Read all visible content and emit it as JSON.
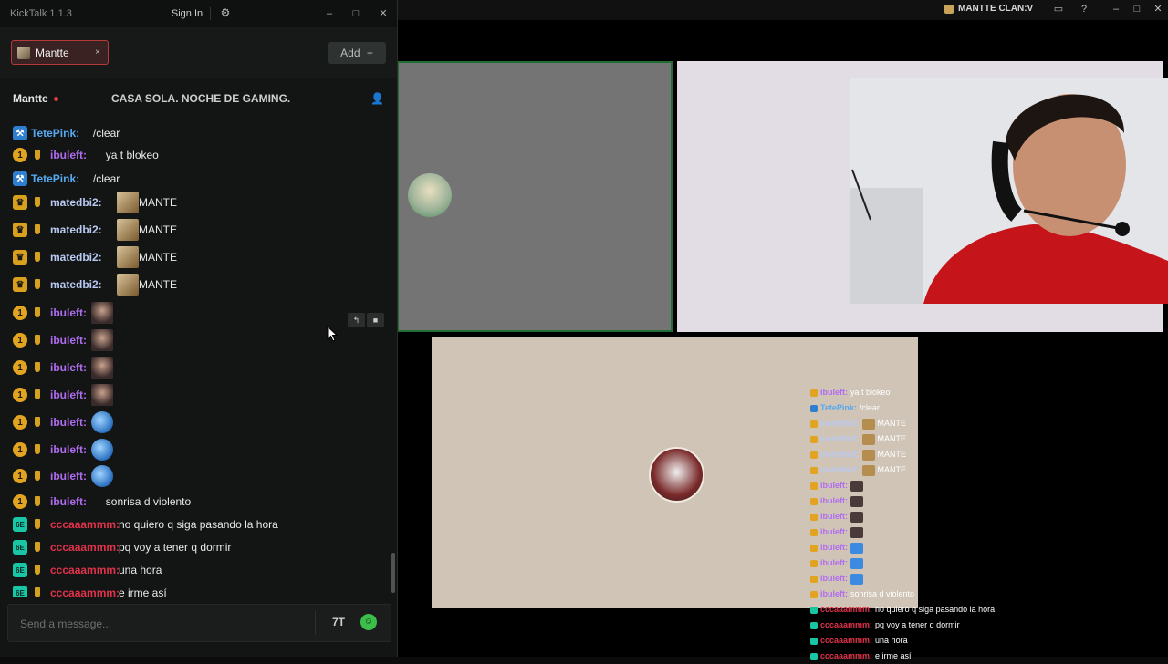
{
  "stream_window": {
    "title": "MANTTE CLAN:V"
  },
  "kicktalk": {
    "app_title": "KickTalk 1.1.3",
    "sign_in_label": "Sign In",
    "tab_label": "Mantte",
    "tab_close": "×",
    "add_label": "Add",
    "add_icon": "+",
    "channel_name": "Mantte",
    "stream_title": "CASA SOLA. NOCHE DE GAMING.",
    "input_placeholder": "Send a message..."
  },
  "chat_messages": [
    {
      "badge": "mod",
      "sub": false,
      "user": "TetePink:",
      "user_color": "#56a8f0",
      "text": "/clear"
    },
    {
      "badge": "gold",
      "sub": true,
      "user": "ibuleft:",
      "user_color": "#b06cf0",
      "text": "ya t blokeo"
    },
    {
      "badge": "mod",
      "sub": false,
      "user": "TetePink:",
      "user_color": "#56a8f0",
      "text": "/clear"
    },
    {
      "badge": "crown",
      "sub": true,
      "user": "matedbi2:",
      "user_color": "#b9c9f2",
      "text": "MANTE"
    },
    {
      "badge": "crown",
      "sub": true,
      "user": "matedbi2:",
      "user_color": "#b9c9f2",
      "text": "MANTE"
    },
    {
      "badge": "crown",
      "sub": true,
      "user": "matedbi2:",
      "user_color": "#b9c9f2",
      "text": "MANTE"
    },
    {
      "badge": "crown",
      "sub": true,
      "user": "matedbi2:",
      "user_color": "#b9c9f2",
      "text": "MANTE"
    },
    {
      "badge": "gold",
      "sub": true,
      "user": "ibuleft:",
      "user_color": "#b06cf0",
      "text": ""
    },
    {
      "badge": "gold",
      "sub": true,
      "user": "ibuleft:",
      "user_color": "#b06cf0",
      "text": ""
    },
    {
      "badge": "gold",
      "sub": true,
      "user": "ibuleft:",
      "user_color": "#b06cf0",
      "text": ""
    },
    {
      "badge": "gold",
      "sub": true,
      "user": "ibuleft:",
      "user_color": "#b06cf0",
      "text": ""
    },
    {
      "badge": "gold",
      "sub": true,
      "user": "ibuleft:",
      "user_color": "#b06cf0",
      "text": ""
    },
    {
      "badge": "gold",
      "sub": true,
      "user": "ibuleft:",
      "user_color": "#b06cf0",
      "text": ""
    },
    {
      "badge": "gold",
      "sub": true,
      "user": "ibuleft:",
      "user_color": "#b06cf0",
      "text": ""
    },
    {
      "badge": "gold",
      "sub": true,
      "user": "ibuleft:",
      "user_color": "#b06cf0",
      "text": "sonrisa d violento"
    },
    {
      "badge": "cc",
      "sub": true,
      "user": "cccaaammm:",
      "user_color": "#e0324a",
      "text": "no quiero q siga pasando la hora"
    },
    {
      "badge": "cc",
      "sub": true,
      "user": "cccaaammm:",
      "user_color": "#e0324a",
      "text": "pq voy a tener q dormir"
    },
    {
      "badge": "cc",
      "sub": true,
      "user": "cccaaammm:",
      "user_color": "#e0324a",
      "text": "una hora"
    },
    {
      "badge": "cc",
      "sub": true,
      "user": "cccaaammm:",
      "user_color": "#e0324a",
      "text": "e irme así"
    }
  ],
  "overlay_chat": [
    {
      "user": "ibuleft:",
      "user_color": "#b06cf0",
      "text": "ya t blokeo"
    },
    {
      "user": "TetePink:",
      "user_color": "#56a8f0",
      "text": "/clear"
    },
    {
      "user": "matedbi2:",
      "user_color": "#b9c9f2",
      "text": "MANTE"
    },
    {
      "user": "matedbi2:",
      "user_color": "#b9c9f2",
      "text": "MANTE"
    },
    {
      "user": "matedbi2:",
      "user_color": "#b9c9f2",
      "text": "MANTE"
    },
    {
      "user": "matedbi2:",
      "user_color": "#b9c9f2",
      "text": "MANTE"
    },
    {
      "user": "ibuleft:",
      "user_color": "#b06cf0",
      "text": ""
    },
    {
      "user": "ibuleft:",
      "user_color": "#b06cf0",
      "text": ""
    },
    {
      "user": "ibuleft:",
      "user_color": "#b06cf0",
      "text": ""
    },
    {
      "user": "ibuleft:",
      "user_color": "#b06cf0",
      "text": ""
    },
    {
      "user": "ibuleft:",
      "user_color": "#b06cf0",
      "text": ""
    },
    {
      "user": "ibuleft:",
      "user_color": "#b06cf0",
      "text": ""
    },
    {
      "user": "ibuleft:",
      "user_color": "#b06cf0",
      "text": ""
    },
    {
      "user": "ibuleft:",
      "user_color": "#b06cf0",
      "text": "sonrisa d violento"
    },
    {
      "user": "cccaaammm:",
      "user_color": "#e0324a",
      "text": "no quiero q siga pasando la hora"
    },
    {
      "user": "cccaaammm:",
      "user_color": "#e0324a",
      "text": "pq voy a tener q dormir"
    },
    {
      "user": "cccaaammm:",
      "user_color": "#e0324a",
      "text": "una hora"
    },
    {
      "user": "cccaaammm:",
      "user_color": "#e0324a",
      "text": "e irme así"
    }
  ],
  "icons": {
    "settings": "gear-icon",
    "minimize": "minimize-icon",
    "maximize": "maximize-icon",
    "close": "close-icon",
    "user": "user-icon",
    "reply": "reply-icon",
    "delete": "delete-icon",
    "emote_7tv": "7tv-emote-icon",
    "emote_kick": "kick-emote-icon"
  }
}
